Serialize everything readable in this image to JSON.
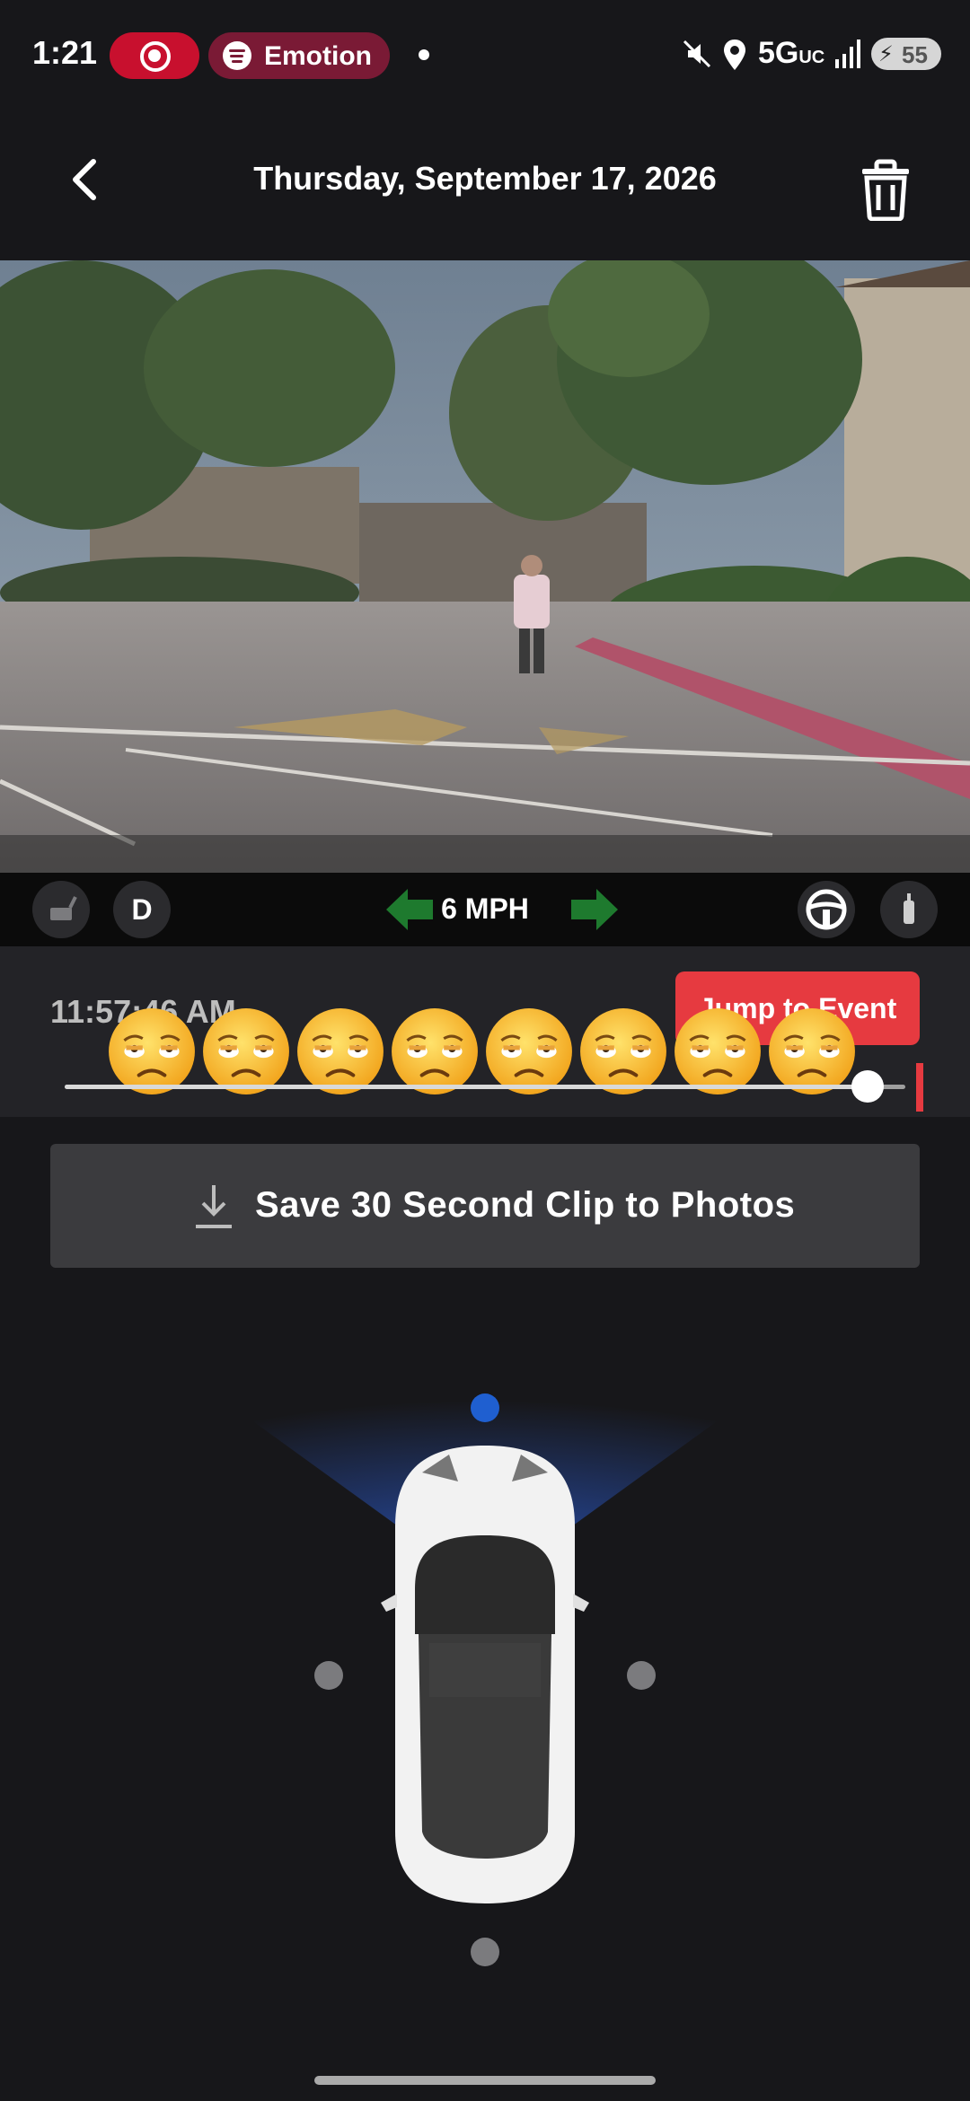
{
  "status_bar": {
    "time": "1:21",
    "recording_indicator": "screen-record-icon",
    "music_app": "Emotion",
    "network": "5G",
    "network_suffix": "UC",
    "battery": "55"
  },
  "header": {
    "title": "Thursday, September 17, 2026",
    "back_icon": "chevron-left-icon",
    "delete_icon": "trash-icon"
  },
  "telemetry": {
    "gear": "D",
    "speed": "6 MPH",
    "left_signal_color": "#1e7a2e",
    "right_signal_color": "#1e7a2e"
  },
  "timeline": {
    "timestamp": "11:57:46 AM",
    "jump_button": "Jump to Event",
    "overlay_emoji_count": 8,
    "playhead_fraction": 0.96
  },
  "save_button": {
    "label": "Save 30 Second Clip to Photos"
  },
  "camera_selector": {
    "active_camera": "front",
    "accent_color": "#1f5fd0"
  }
}
